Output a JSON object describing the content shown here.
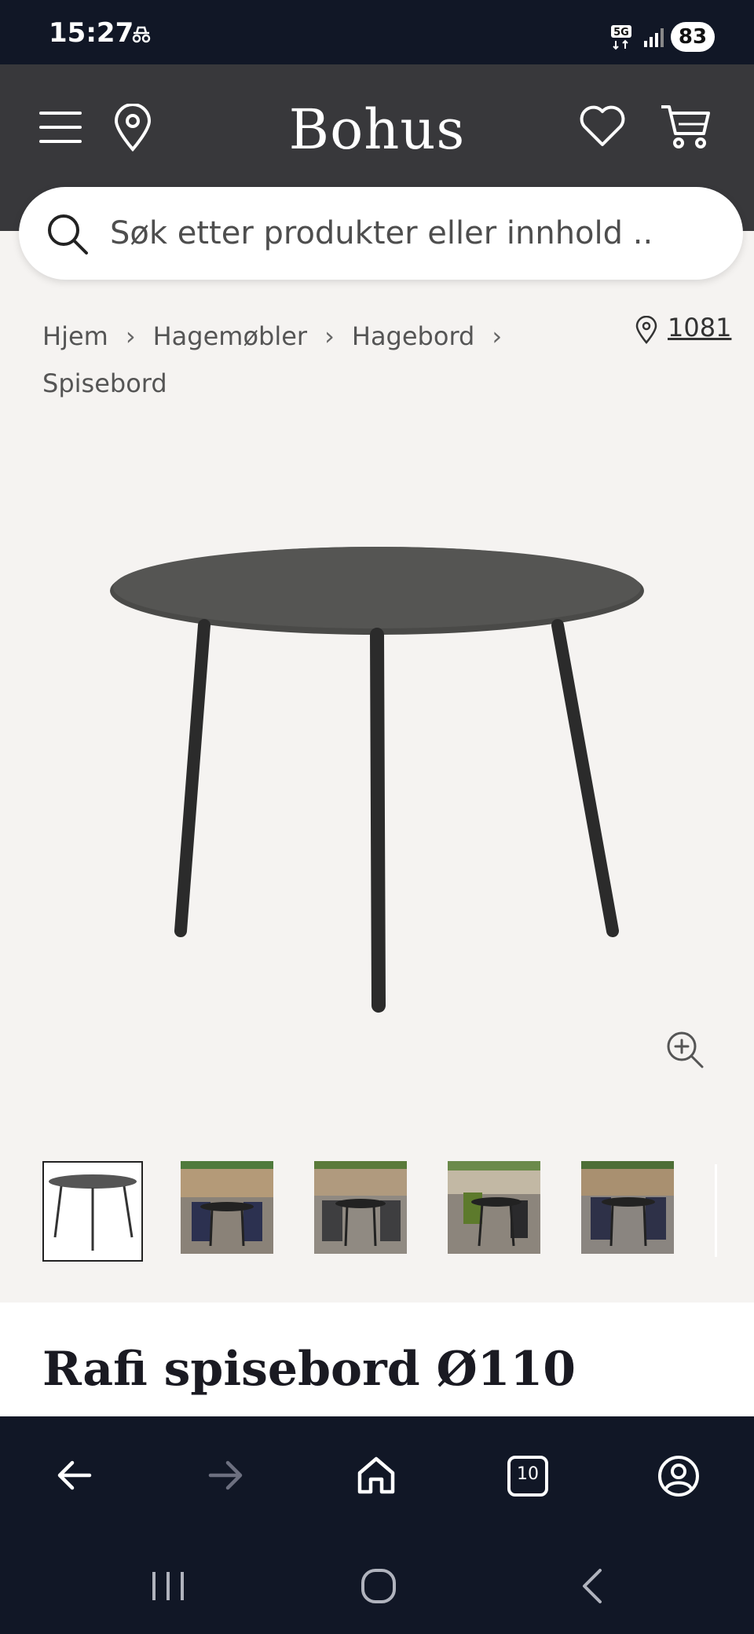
{
  "status_bar": {
    "time": "15:27",
    "battery": "83"
  },
  "header": {
    "logo": "Bohus"
  },
  "search": {
    "placeholder": "Søk etter produkter eller innhold .."
  },
  "breadcrumb": {
    "items": [
      "Hjem",
      "Hagemøbler",
      "Hagebord",
      "Spisebord"
    ]
  },
  "store": {
    "code": "1081"
  },
  "product": {
    "title": "Rafi spisebord Ø110"
  },
  "browser": {
    "tab_count": "10"
  },
  "icons": [
    "menu-icon",
    "location-pin-icon",
    "heart-icon",
    "cart-icon",
    "search-icon",
    "zoom-in-icon",
    "back-arrow-icon",
    "forward-arrow-icon",
    "home-icon",
    "tabs-icon",
    "account-icon"
  ]
}
